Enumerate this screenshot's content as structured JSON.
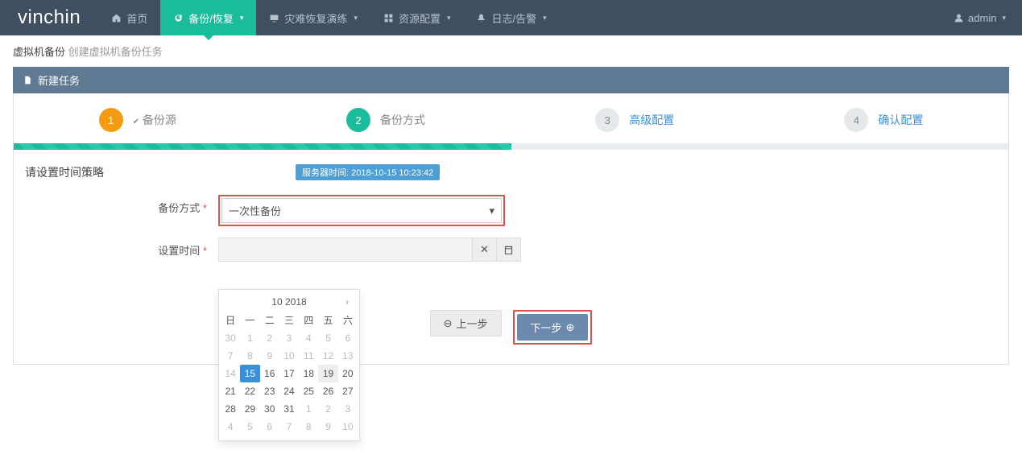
{
  "brand": "vinchin",
  "nav": {
    "home": "首页",
    "backup": "备份/恢复",
    "dr": "灾难恢复演练",
    "resource": "资源配置",
    "log": "日志/告警"
  },
  "user": {
    "name": "admin"
  },
  "breadcrumb": {
    "main": "虚拟机备份",
    "sub": "创建虚拟机备份任务"
  },
  "panel": {
    "title": "新建任务"
  },
  "steps": {
    "s1": {
      "num": "1",
      "label": "备份源"
    },
    "s2": {
      "num": "2",
      "label": "备份方式"
    },
    "s3": {
      "num": "3",
      "label": "高级配置"
    },
    "s4": {
      "num": "4",
      "label": "确认配置"
    }
  },
  "form": {
    "title": "请设置时间策略",
    "server_time_label": "服务器时间: 2018-10-15 10:23:42",
    "mode_label": "备份方式",
    "mode_value": "一次性备份",
    "time_label": "设置时间"
  },
  "calendar": {
    "title": "10 2018",
    "dow": [
      "日",
      "一",
      "二",
      "三",
      "四",
      "五",
      "六"
    ],
    "weeks": [
      [
        {
          "d": "30",
          "m": true
        },
        {
          "d": "1",
          "m": true
        },
        {
          "d": "2",
          "m": true
        },
        {
          "d": "3",
          "m": true
        },
        {
          "d": "4",
          "m": true
        },
        {
          "d": "5",
          "m": true
        },
        {
          "d": "6",
          "m": true
        }
      ],
      [
        {
          "d": "7",
          "m": true
        },
        {
          "d": "8",
          "m": true
        },
        {
          "d": "9",
          "m": true
        },
        {
          "d": "10",
          "m": true
        },
        {
          "d": "11",
          "m": true
        },
        {
          "d": "12",
          "m": true
        },
        {
          "d": "13",
          "m": true
        }
      ],
      [
        {
          "d": "14",
          "m": true
        },
        {
          "d": "15",
          "sel": true
        },
        {
          "d": "16"
        },
        {
          "d": "17"
        },
        {
          "d": "18"
        },
        {
          "d": "19",
          "hov": true
        },
        {
          "d": "20"
        }
      ],
      [
        {
          "d": "21"
        },
        {
          "d": "22"
        },
        {
          "d": "23"
        },
        {
          "d": "24"
        },
        {
          "d": "25"
        },
        {
          "d": "26"
        },
        {
          "d": "27"
        }
      ],
      [
        {
          "d": "28"
        },
        {
          "d": "29"
        },
        {
          "d": "30"
        },
        {
          "d": "31"
        },
        {
          "d": "1",
          "m": true
        },
        {
          "d": "2",
          "m": true
        },
        {
          "d": "3",
          "m": true
        }
      ],
      [
        {
          "d": "4",
          "m": true
        },
        {
          "d": "5",
          "m": true
        },
        {
          "d": "6",
          "m": true
        },
        {
          "d": "7",
          "m": true
        },
        {
          "d": "8",
          "m": true
        },
        {
          "d": "9",
          "m": true
        },
        {
          "d": "10",
          "m": true
        }
      ]
    ]
  },
  "buttons": {
    "prev": "上一步",
    "next": "下一步"
  }
}
